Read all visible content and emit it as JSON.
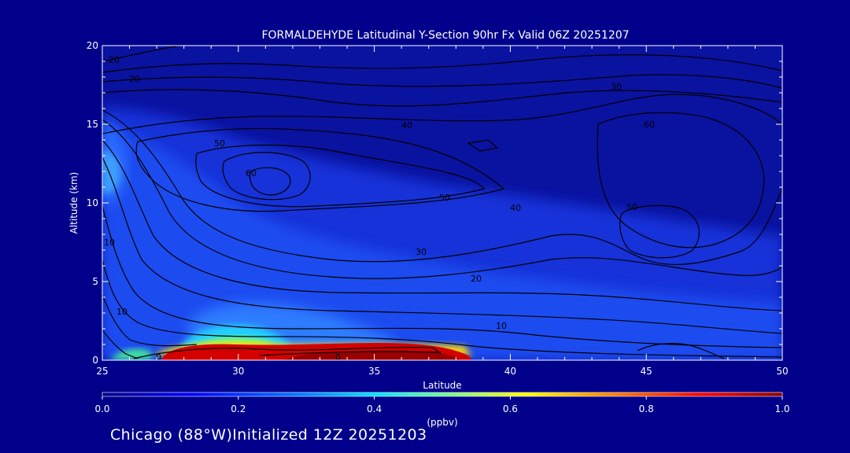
{
  "title": "FORMALDEHYDE Latitudinal Y-Section 90hr  Fx Valid 06Z 20251207",
  "footer": "Chicago (88°W)Initialized 12Z 20251203",
  "colors": {
    "background": "#00008b",
    "text": "#ffffff",
    "contour": "#000000"
  },
  "chart_data": {
    "type": "heatmap",
    "title": "FORMALDEHYDE Latitudinal Y-Section 90hr  Fx Valid 06Z 20251207",
    "xlabel": "Latitude",
    "ylabel": "Altitude (km)",
    "xlim": [
      25,
      50
    ],
    "ylim": [
      0,
      20
    ],
    "x_ticks": [
      25,
      30,
      35,
      40,
      45,
      50
    ],
    "y_ticks": [
      0,
      5,
      10,
      15,
      20
    ],
    "colorbar": {
      "label": "(ppbv)",
      "range": [
        0.0,
        1.0
      ],
      "ticks": [
        "0.0",
        "0.2",
        "0.4",
        "0.6",
        "0.8",
        "1.0"
      ]
    },
    "fill_regions": [
      {
        "lat": [
          25,
          50
        ],
        "alt": [
          0,
          20
        ],
        "value": 0.05
      },
      {
        "lat": [
          25,
          50
        ],
        "alt": [
          0,
          9.0
        ],
        "value": 0.12
      },
      {
        "lat": [
          25,
          27
        ],
        "alt": [
          8,
          16
        ],
        "value": 0.15
      },
      {
        "lat": [
          25,
          26
        ],
        "alt": [
          11,
          14
        ],
        "value": 0.28
      },
      {
        "lat": [
          26.5,
          36
        ],
        "alt": [
          1.5,
          4.5
        ],
        "value": 0.22
      },
      {
        "lat": [
          28,
          32
        ],
        "alt": [
          1.0,
          2.2
        ],
        "value": 0.35
      },
      {
        "lat": [
          29,
          31
        ],
        "alt": [
          0.6,
          1.3
        ],
        "value": 0.5
      },
      {
        "lat": [
          27.3,
          39
        ],
        "alt": [
          0,
          0.9
        ],
        "value": 0.92
      },
      {
        "lat": [
          25.5,
          27
        ],
        "alt": [
          0,
          0.6
        ],
        "value": 0.55
      }
    ],
    "contour_levels": [
      10,
      20,
      30,
      40,
      50,
      60
    ],
    "contour_labels": [
      "0",
      "0",
      "10",
      "10",
      "20",
      "30",
      "40",
      "40",
      "50",
      "50",
      "50",
      "60",
      "60",
      "30",
      "20",
      "20",
      "10"
    ]
  }
}
